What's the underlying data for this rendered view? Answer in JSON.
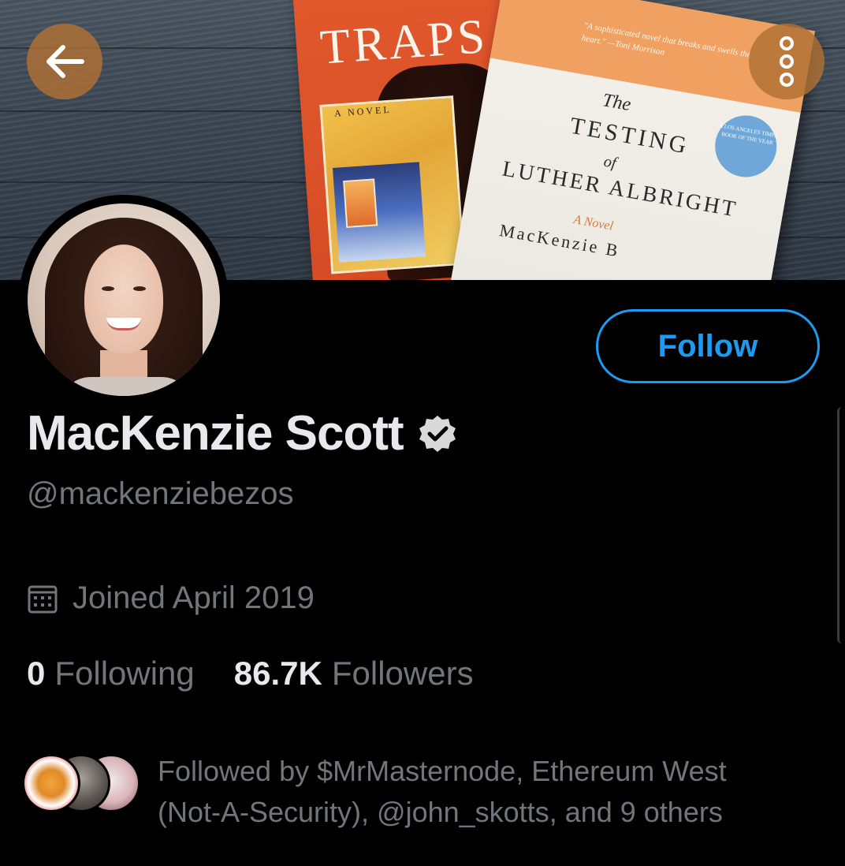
{
  "banner": {
    "book1": {
      "title": "TRAPS",
      "subtitle": "A NOVEL"
    },
    "book2": {
      "quote": "\"A sophisticated novel that breaks and swells the heart.\" —Toni Morrison",
      "the": "The",
      "testing": "TESTING",
      "of": "of",
      "luther": "LUTHER ALBRIGHT",
      "novel": "A Novel",
      "author": "MacKenzie B",
      "seal": "A LOS ANGELES TIMES BOOK OF THE YEAR"
    }
  },
  "nav": {
    "back_icon": "arrow-left",
    "more_icon": "more-vertical-circles"
  },
  "profile": {
    "name": "MacKenzie Scott",
    "verified_icon": "verified-badge",
    "handle": "@mackenziebezos",
    "joined": "Joined April 2019",
    "following_count": "0",
    "following_label": "Following",
    "followers_count": "86.7K",
    "followers_label": "Followers",
    "followed_by": "Followed by $MrMasternode, Ethereum West (Not-A-Security), @john_skotts, and 9 others"
  },
  "actions": {
    "follow_label": "Follow"
  },
  "colors": {
    "accent": "#1d9bf0",
    "muted": "#71767b",
    "text": "#e7e9ea",
    "background": "#000000",
    "nav_button": "#b07034"
  }
}
